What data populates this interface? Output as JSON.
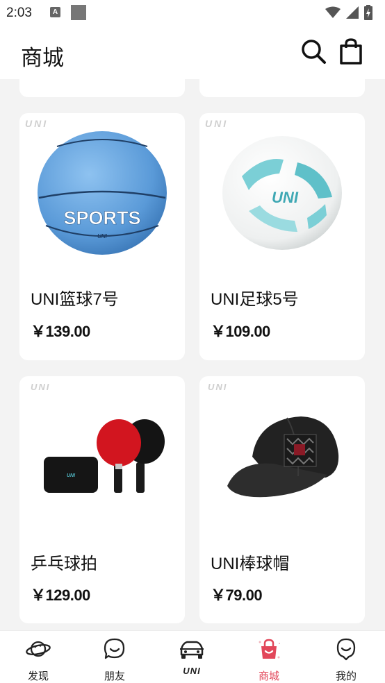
{
  "status_bar": {
    "time": "2:03",
    "notification_letter": "A"
  },
  "header": {
    "title": "商城"
  },
  "brand": {
    "logo_text": "UNI"
  },
  "products": [
    {
      "name": "UNI篮球7号",
      "price": "￥139.00",
      "image": "basketball-image"
    },
    {
      "name": "UNI足球5号",
      "price": "￥109.00",
      "image": "soccer-ball-image"
    },
    {
      "name": "乒乓球拍",
      "price": "￥129.00",
      "image": "ping-pong-paddles-image"
    },
    {
      "name": "UNI棒球帽",
      "price": "￥79.00",
      "image": "baseball-cap-image"
    }
  ],
  "tabs": [
    {
      "label": "发现",
      "icon": "planet-icon"
    },
    {
      "label": "朋友",
      "icon": "chat-smile-icon"
    },
    {
      "label": "UNI",
      "icon": "car-icon"
    },
    {
      "label": "商城",
      "icon": "shopping-bag-icon",
      "active": true
    },
    {
      "label": "我的",
      "icon": "profile-smile-icon"
    }
  ],
  "colors": {
    "accent": "#e2475a",
    "background": "#f3f3f3",
    "card": "#ffffff"
  }
}
